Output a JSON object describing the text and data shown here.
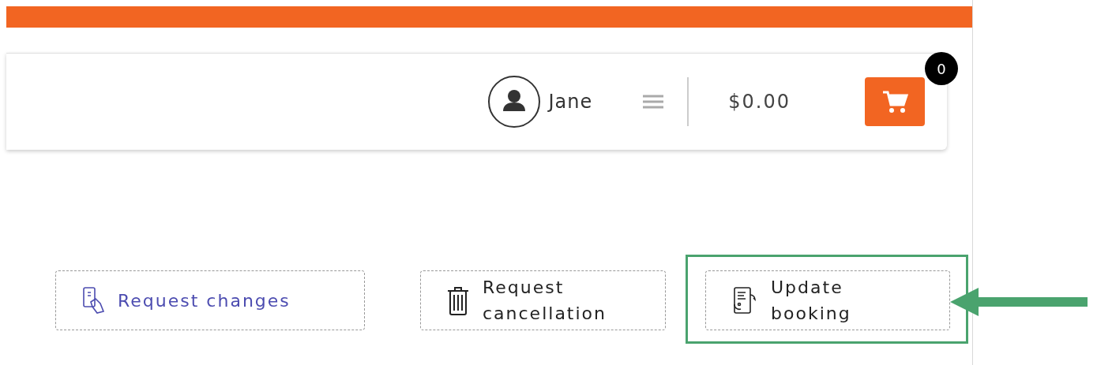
{
  "header": {
    "user": {
      "name": "Jane"
    },
    "total": "$0.00",
    "cart": {
      "count": "0"
    }
  },
  "actions": [
    {
      "kind": "changes",
      "label": "Request changes",
      "color": "#4c4cb0",
      "highlighted": false
    },
    {
      "kind": "cancel",
      "label": "Request cancellation",
      "color": "#222222",
      "highlighted": false
    },
    {
      "kind": "update",
      "label": "Update booking",
      "color": "#222222",
      "highlighted": true
    }
  ],
  "callout": {
    "kind": "arrow"
  }
}
